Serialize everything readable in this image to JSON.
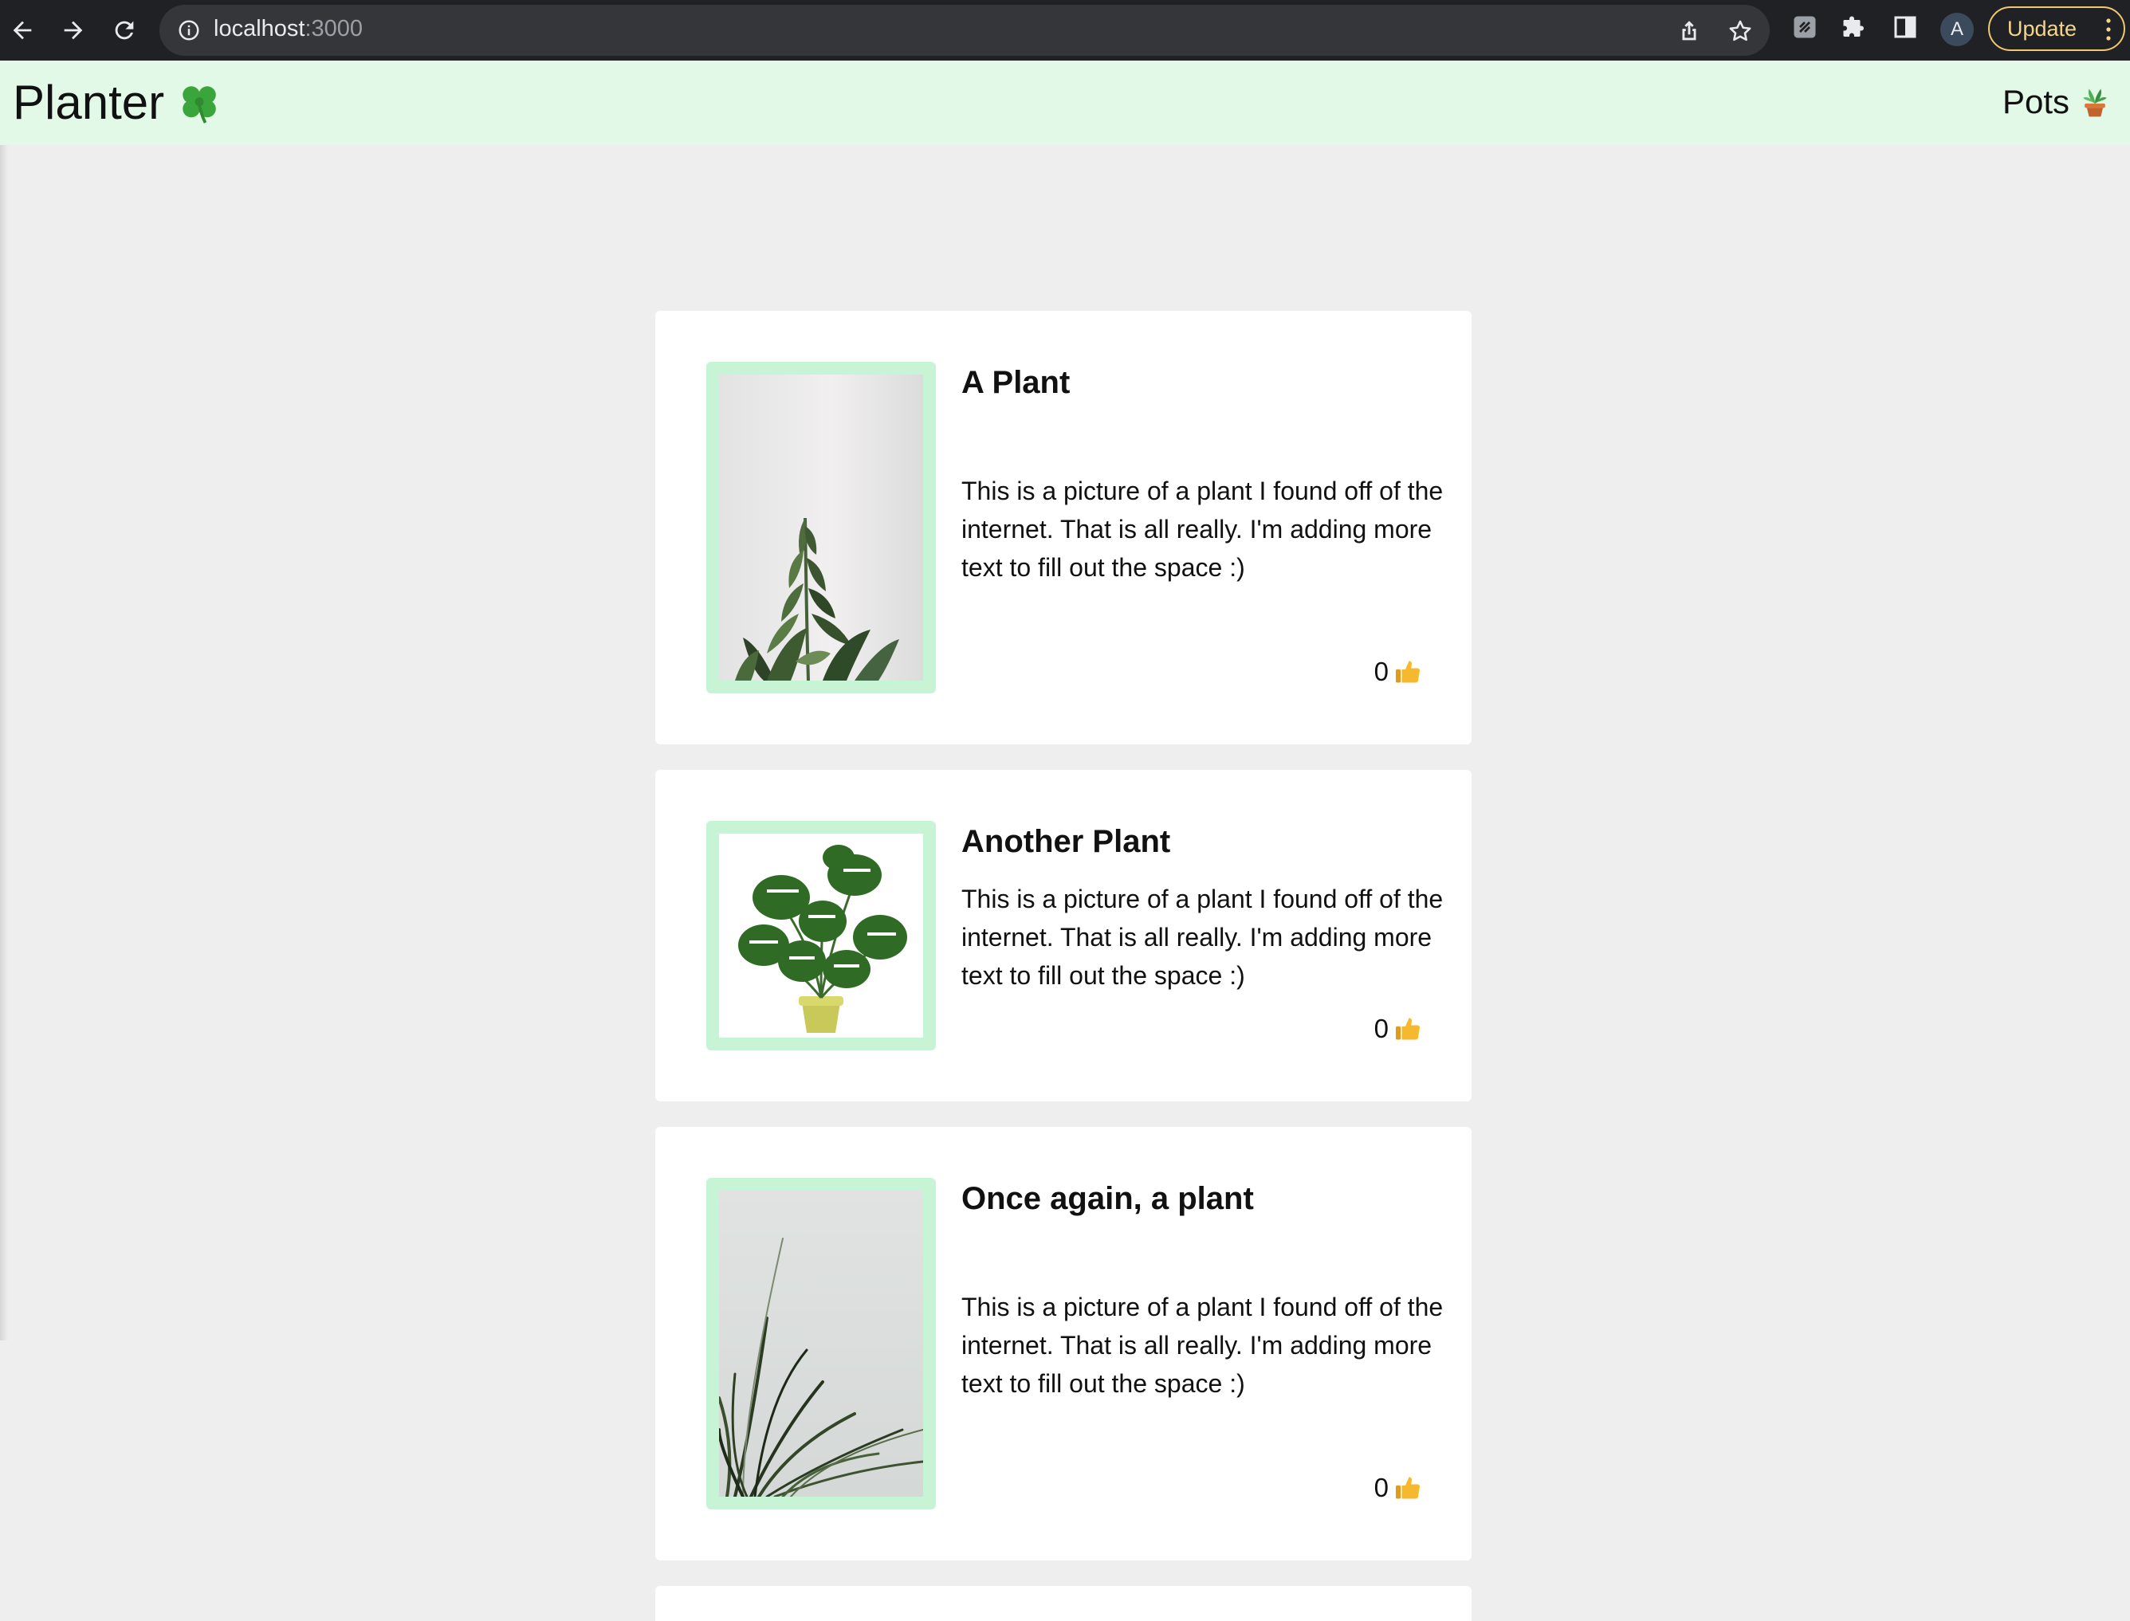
{
  "browser": {
    "url_host": "localhost",
    "url_port": ":3000",
    "profile_initial": "A",
    "update_label": "Update"
  },
  "header": {
    "brand": "Planter",
    "brand_icon": "four-leaf-clover",
    "nav_link": "Pots",
    "nav_icon": "potted-plant"
  },
  "colors": {
    "header_bg": "#e1f9e6",
    "frame": "#c8f4d6",
    "page_bg": "#eeeeee"
  },
  "posts": [
    {
      "title": "A Plant",
      "description": "This is a picture of a plant I found off of the internet. That is all really. I'm adding more text to fill out the space :)",
      "likes": "0",
      "image": "plant-photo-zz"
    },
    {
      "title": "Another Plant",
      "description": "This is a picture of a plant I found off of the internet. That is all really. I'm adding more text to fill out the space :)",
      "likes": "0",
      "image": "plant-photo-monstera"
    },
    {
      "title": "Once again, a plant",
      "description": "This is a picture of a plant I found off of the internet. That is all really. I'm adding more text to fill out the space :)",
      "likes": "0",
      "image": "plant-photo-grass"
    }
  ]
}
